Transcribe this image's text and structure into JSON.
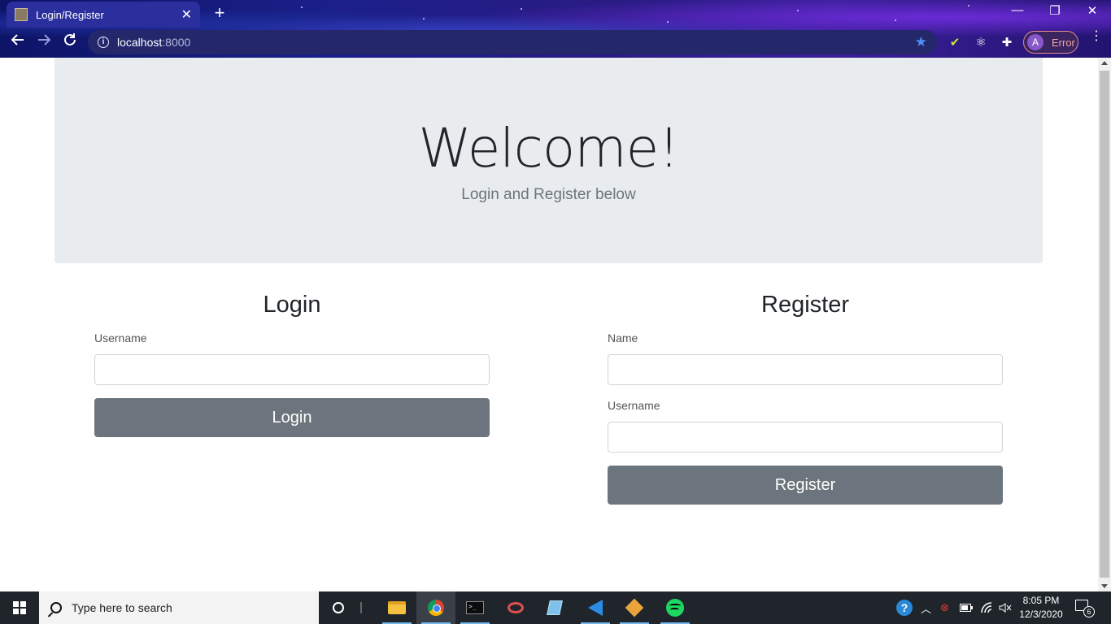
{
  "browser": {
    "tab_title": "Login/Register",
    "tab_close": "✕",
    "new_tab": "+",
    "url_host": "localhost",
    "url_port": ":8000",
    "profile_initial": "A",
    "profile_status": "Error",
    "window_controls": {
      "minimize": "—",
      "restore": "❐",
      "close": "✕"
    }
  },
  "jumbotron": {
    "title": "Welcome!",
    "subtitle": "Login and Register below"
  },
  "login": {
    "heading": "Login",
    "username_label": "Username",
    "username_value": "",
    "submit_label": "Login"
  },
  "register": {
    "heading": "Register",
    "name_label": "Name",
    "name_value": "",
    "username_label": "Username",
    "username_value": "",
    "submit_label": "Register"
  },
  "taskbar": {
    "search_placeholder": "Type here to search",
    "time": "8:05 PM",
    "date": "12/3/2020",
    "notification_count": "6",
    "pinned_apps": [
      "file-explorer",
      "chrome",
      "terminal",
      "snipping-tool",
      "notepad",
      "vscode",
      "git",
      "spotify"
    ]
  },
  "colors": {
    "jumbotron_bg": "#e9ecef",
    "button_bg": "#6c757d",
    "bookmark_star": "#4d8ff5",
    "error_border": "#e98b8b"
  }
}
